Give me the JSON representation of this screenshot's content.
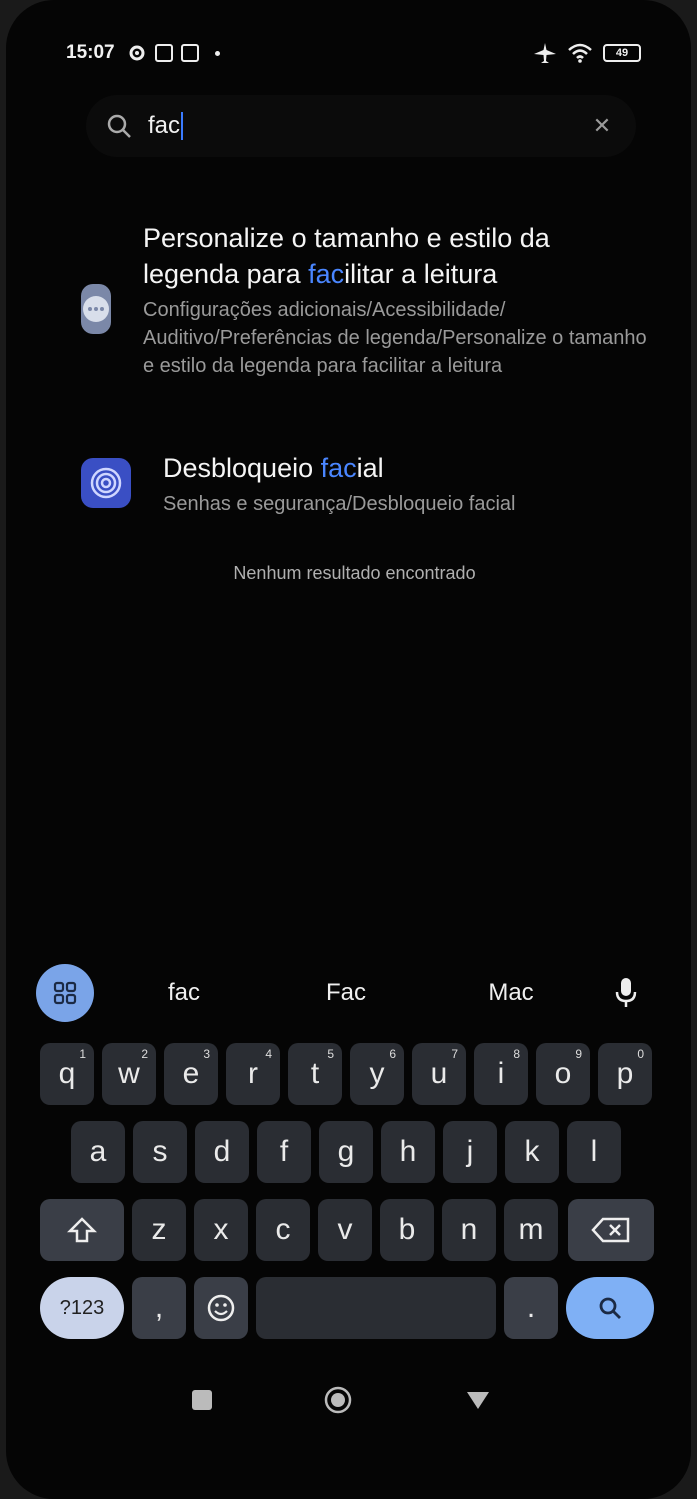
{
  "status_bar": {
    "time": "15:07",
    "battery": "49"
  },
  "search": {
    "value": "fac",
    "clear_icon": "close-icon"
  },
  "results": [
    {
      "title_pre": "Personalize o tamanho e estilo da legenda para ",
      "title_hl": "fac",
      "title_post": "ilitar a leitura",
      "path": "Configurações adicionais/Acessibilidade/ Auditivo/Preferências de legenda/Personalize o tamanho e estilo da legenda para facilitar a leitura",
      "icon": "more-dots-icon"
    },
    {
      "title_pre": "Desbloqueio ",
      "title_hl": "fac",
      "title_post": "ial",
      "path": "Senhas e segurança/Desbloqueio facial",
      "icon": "face-unlock-icon"
    }
  ],
  "no_results": "Nenhum resultado encontrado",
  "suggestions": [
    "fac",
    "Fac",
    "Mac"
  ],
  "keyboard": {
    "row1": [
      {
        "k": "q",
        "n": "1"
      },
      {
        "k": "w",
        "n": "2"
      },
      {
        "k": "e",
        "n": "3"
      },
      {
        "k": "r",
        "n": "4"
      },
      {
        "k": "t",
        "n": "5"
      },
      {
        "k": "y",
        "n": "6"
      },
      {
        "k": "u",
        "n": "7"
      },
      {
        "k": "i",
        "n": "8"
      },
      {
        "k": "o",
        "n": "9"
      },
      {
        "k": "p",
        "n": "0"
      }
    ],
    "row2": [
      "a",
      "s",
      "d",
      "f",
      "g",
      "h",
      "j",
      "k",
      "l"
    ],
    "row3": [
      "z",
      "x",
      "c",
      "v",
      "b",
      "n",
      "m"
    ],
    "sym_label": "?123",
    "comma": ",",
    "period": "."
  },
  "colors": {
    "accent": "#4a86ff",
    "keyboard_key": "#2a2d33",
    "search_key": "#7fb0f5"
  }
}
